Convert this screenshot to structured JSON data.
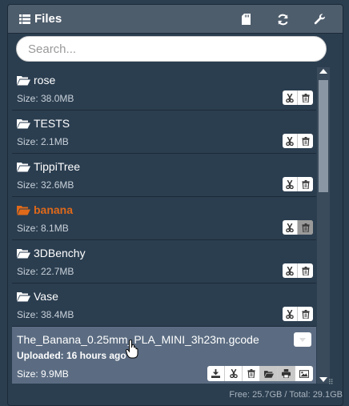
{
  "header": {
    "title": "Files",
    "icons": [
      "list-icon",
      "sd-card-icon",
      "refresh-icon",
      "wrench-icon"
    ]
  },
  "search": {
    "placeholder": "Search..."
  },
  "folders": [
    {
      "name": "rose",
      "size": "Size: 38.0MB",
      "selected": false
    },
    {
      "name": "TESTS",
      "size": "Size: 2.1MB",
      "selected": false
    },
    {
      "name": "TippiTree",
      "size": "Size: 32.6MB",
      "selected": false
    },
    {
      "name": "banana",
      "size": "Size: 8.1MB",
      "selected": true
    },
    {
      "name": "3DBenchy",
      "size": "Size: 22.7MB",
      "selected": false
    },
    {
      "name": "Vase",
      "size": "Size: 38.4MB",
      "selected": false
    }
  ],
  "file": {
    "name": "The_Banana_0.25mm_PLA_MINI_3h23m.gcode",
    "uploaded": "Uploaded: 16 hours ago",
    "size": "Size: 9.9MB"
  },
  "footer": {
    "storage": "Free: 25.7GB / Total: 29.1GB"
  },
  "colors": {
    "accent": "#df691a",
    "panel": "#2b3e50",
    "header": "#4e5d6c",
    "file_bg": "#5b6c82"
  }
}
